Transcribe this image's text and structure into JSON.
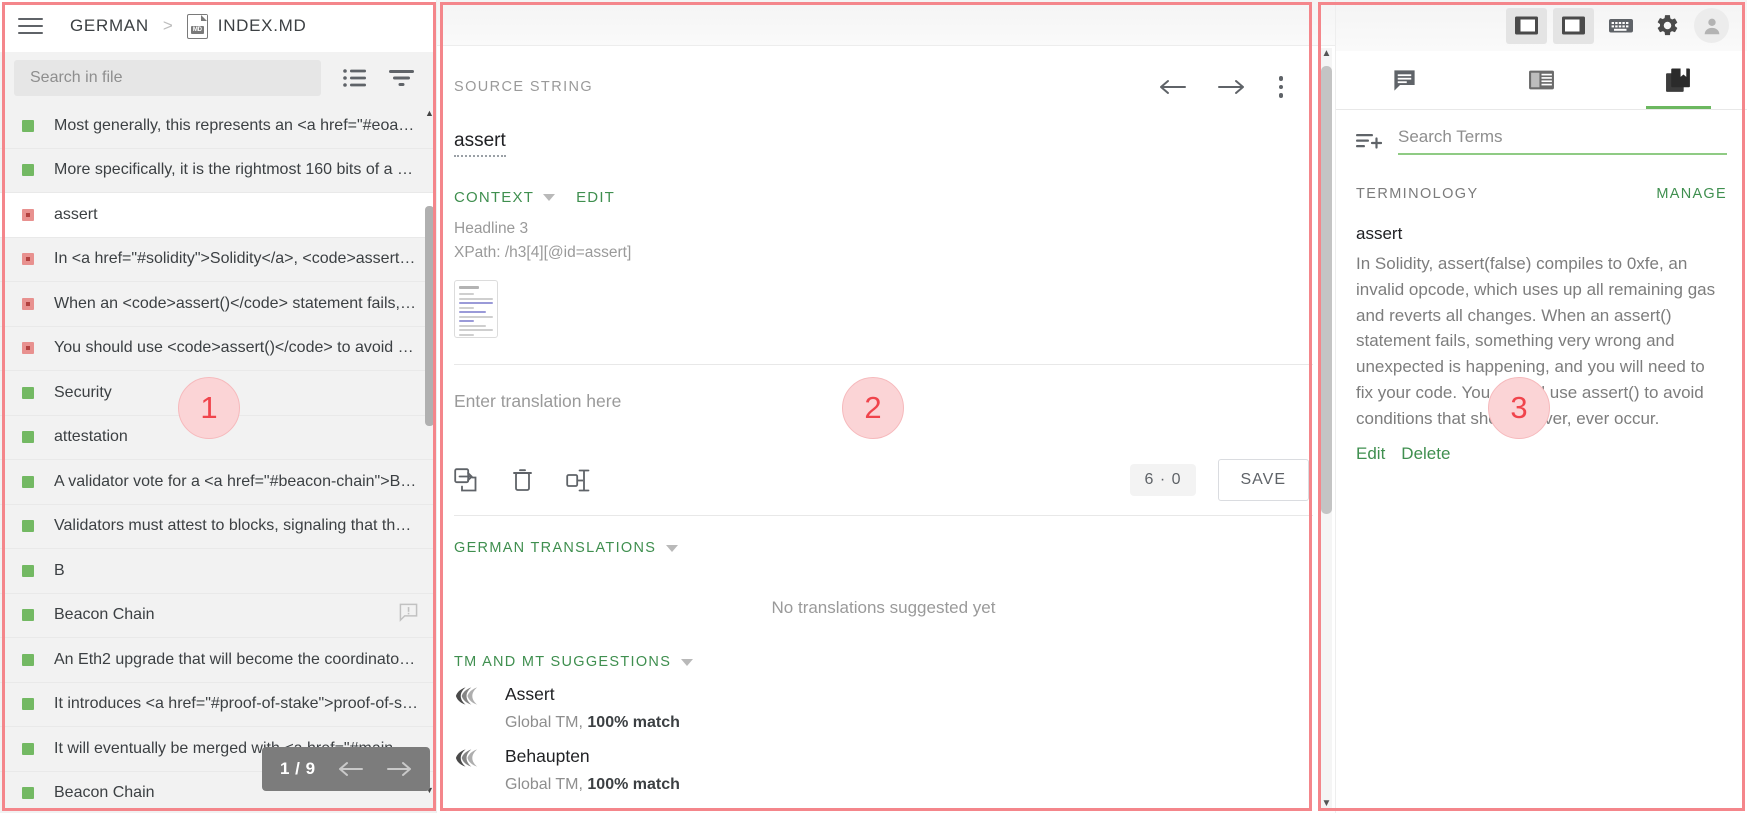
{
  "left": {
    "menu_icon": "hamburger-icon",
    "breadcrumb_project": "GERMAN",
    "breadcrumb_sep": ">",
    "breadcrumb_file": "INDEX.MD",
    "file_badge_text": "MD",
    "search_placeholder": "Search in file",
    "search_value": "",
    "list_view_icon": "list-view-icon",
    "filter_icon": "filter-icon",
    "segments": [
      {
        "status": "green",
        "text": "Most generally, this represents an <a href=\"#eoa\"…",
        "comment": false
      },
      {
        "status": "green",
        "text": "More specifically, it is the rightmost 160 bits of a …",
        "comment": false
      },
      {
        "status": "red",
        "text": "assert",
        "comment": false,
        "selected": true
      },
      {
        "status": "red",
        "text": "In <a href=\"#solidity\">Solidity</a>, <code>assert(…",
        "comment": false
      },
      {
        "status": "red",
        "text": "When an <code>assert()</code> statement fails, …",
        "comment": false
      },
      {
        "status": "red",
        "text": "You should use <code>assert()</code> to avoid c…",
        "comment": false
      },
      {
        "status": "green",
        "text": "Security",
        "comment": false
      },
      {
        "status": "green",
        "text": "attestation",
        "comment": false
      },
      {
        "status": "green",
        "text": "A validator vote for a <a href=\"#beacon-chain\">Be…",
        "comment": false
      },
      {
        "status": "green",
        "text": "Validators must attest to blocks, signaling that th…",
        "comment": false
      },
      {
        "status": "green",
        "text": "B",
        "comment": false
      },
      {
        "status": "green",
        "text": "Beacon Chain",
        "comment": true
      },
      {
        "status": "green",
        "text": "An Eth2 upgrade that will become the coordinator…",
        "comment": false
      },
      {
        "status": "green",
        "text": "It introduces <a href=\"#proof-of-stake\">proof-of-s…",
        "comment": false
      },
      {
        "status": "green",
        "text": "It will eventually be merged with <a href=\"#mainn…",
        "comment": false
      },
      {
        "status": "green",
        "text": "Beacon Chain",
        "comment": false
      }
    ],
    "pager": {
      "label": "1 / 9",
      "prev_icon": "arrow-left-icon",
      "next_icon": "arrow-right-icon"
    }
  },
  "middle": {
    "source_section_label": "SOURCE STRING",
    "prev_icon": "arrow-left-icon",
    "next_icon": "arrow-right-icon",
    "more_icon": "kebab-menu-icon",
    "source_string": "assert",
    "context_label": "CONTEXT",
    "edit_label": "EDIT",
    "context_headline": "Headline 3",
    "context_xpath": "XPath: /h3[4][@id=assert]",
    "translation_placeholder": "Enter translation here",
    "translation_value": "",
    "tool_icons": [
      "copy-source-icon",
      "clear-translation-icon",
      "insert-tag-icon"
    ],
    "counter": "6 · 0",
    "save_label": "SAVE",
    "translations_section_label": "GERMAN TRANSLATIONS",
    "no_translations_msg": "No translations suggested yet",
    "suggestions_section_label": "TM AND MT SUGGESTIONS",
    "suggestions": [
      {
        "text": "Assert",
        "source": "Global TM, ",
        "match": "100% match"
      },
      {
        "text": "Behaupten",
        "source": "Global TM, ",
        "match": "100% match"
      }
    ]
  },
  "right": {
    "top_buttons": [
      {
        "name": "toggle-left-panel-button",
        "icon": "panel-left-icon",
        "active": true
      },
      {
        "name": "toggle-right-panel-button",
        "icon": "panel-right-icon",
        "active": true
      },
      {
        "name": "keyboard-shortcuts-button",
        "icon": "keyboard-icon",
        "active": false
      },
      {
        "name": "settings-button",
        "icon": "gear-icon",
        "active": false
      }
    ],
    "avatar_icon": "user-avatar-icon",
    "tabs": [
      {
        "name": "tab-comments",
        "icon": "comment-icon",
        "active": false
      },
      {
        "name": "tab-reference",
        "icon": "reference-panel-icon",
        "active": false
      },
      {
        "name": "tab-glossary",
        "icon": "glossary-book-icon",
        "active": true
      }
    ],
    "add_term_icon": "add-term-icon",
    "search_placeholder": "Search Terms",
    "search_value": "",
    "terminology_label": "TERMINOLOGY",
    "manage_label": "MANAGE",
    "term": {
      "title": "assert",
      "definition": "In Solidity, assert(false) compiles to 0xfe, an invalid opcode, which uses up all remaining gas and reverts all changes. When an assert() statement fails, something very wrong and unexpected is happening, and you will need to fix your code. You should use assert() to avoid conditions that should never, ever occur.",
      "edit_label": "Edit",
      "delete_label": "Delete"
    }
  },
  "annotations": [
    {
      "label": "1"
    },
    {
      "label": "2"
    },
    {
      "label": "3"
    }
  ],
  "colors": {
    "accent_green": "#3f8f4f",
    "annotation_red": "#f0444c",
    "status_green": "#73b963",
    "status_red": "#e8918f"
  }
}
